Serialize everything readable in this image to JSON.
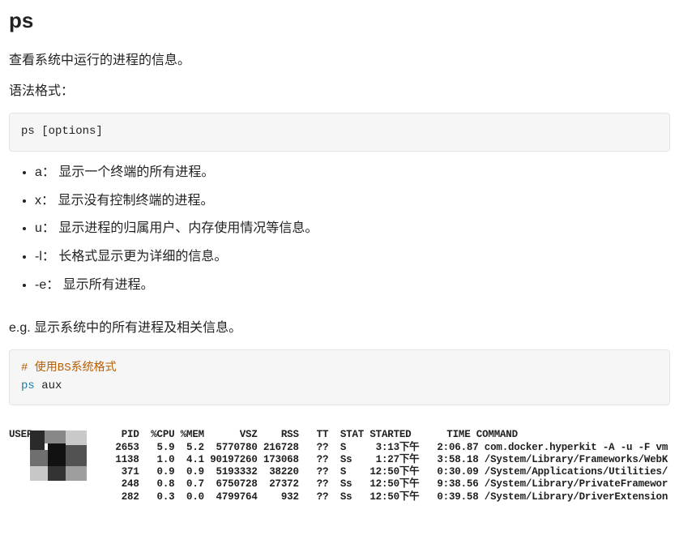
{
  "title": "ps",
  "intro": "查看系统中运行的进程的信息。",
  "syntax_label": "语法格式：",
  "syntax_code": "ps [options]",
  "options": [
    "a： 显示一个终端的所有进程。",
    "x： 显示没有控制终端的进程。",
    "u： 显示进程的归属用户、内存使用情况等信息。",
    "-l： 长格式显示更为详细的信息。",
    "-e： 显示所有进程。"
  ],
  "example_label": "e.g. 显示系统中的所有进程及相关信息。",
  "code2": {
    "comment": "# 使用BS系统格式",
    "cmd": "ps",
    "args": " aux"
  },
  "output": {
    "header": "USER               PID  %CPU %MEM      VSZ    RSS   TT  STAT STARTED      TIME COMMAND",
    "rows": [
      "                  2653   5.9  5.2  5770780 216728   ??  S     3:13下午   2:06.87 com.docker.hyperkit -A -u -F vm",
      "                  1138   1.0  4.1 90197260 173068   ??  Ss    1:27下午   3:58.18 /System/Library/Frameworks/WebK",
      "                   371   0.9  0.9  5193332  38220   ??  S    12:50下午   0:30.09 /System/Applications/Utilities/",
      "                   248   0.8  0.7  6750728  27372   ??  Ss   12:50下午   9:38.56 /System/Library/PrivateFramewor",
      "                   282   0.3  0.0  4799764    932   ??  Ss   12:50下午   0:39.58 /System/Library/DriverExtension"
    ]
  }
}
